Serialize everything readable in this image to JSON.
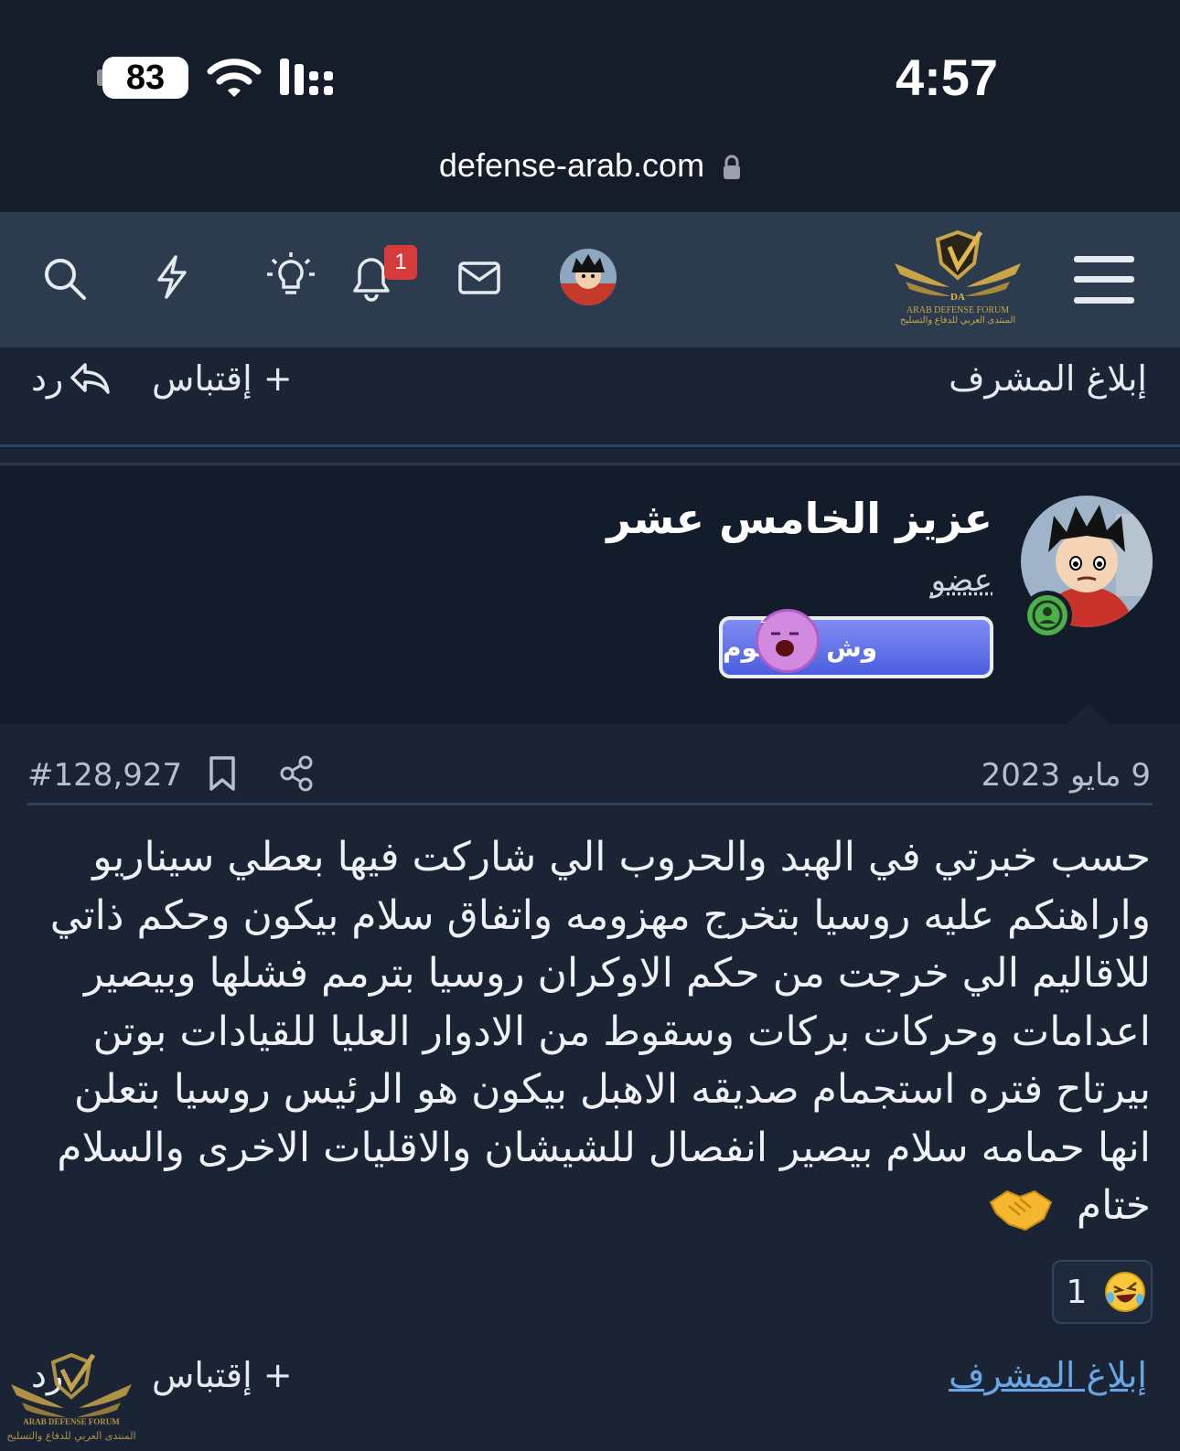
{
  "status": {
    "battery": "83",
    "time": "4:57"
  },
  "browser": {
    "url": "defense-arab.com"
  },
  "nav": {
    "notification_count": "1",
    "logo_line1": "ARAB DEFENSE FORUM",
    "logo_line2": "المنتدى العربي للدفاع والتسليح"
  },
  "top_actions": {
    "report": "إبلاغ المشرف",
    "quote": "+ إقتباس",
    "reply": "رد"
  },
  "author": {
    "name": "عزيز الخامس عشر",
    "role": "عضو",
    "banner": "وش ذا النوم"
  },
  "post": {
    "date": "9 مايو 2023",
    "number": "#128,927",
    "body": "حسب خبرتي في الهبد والحروب الي شاركت فيها بعطي سيناريو واراهنكم عليه روسيا بتخرج مهزومه واتفاق سلام بيكون وحكم ذاتي للاقاليم الي خرجت من حكم الاوكران روسيا بترمم فشلها وبيصير اعدامات وحركات بركات وسقوط من الادوار العليا للقيادات بوتن بيرتاح فتره استجمام صديقه الاهبل بيكون هو الرئيس روسيا بتعلن انها حمامه سلام بيصير انفصال للشيشان والاقليات الاخرى والسلام ختام",
    "reaction_count": "1"
  },
  "bottom_actions": {
    "report": "إبلاغ المشرف",
    "quote": "+ إقتباس",
    "reply": "رد"
  },
  "colors": {
    "background": "#1a2434",
    "nav_background": "#2c3b4e",
    "author_background": "#131c2a",
    "link": "#6aa6e6",
    "badge": "#d63b3b"
  }
}
